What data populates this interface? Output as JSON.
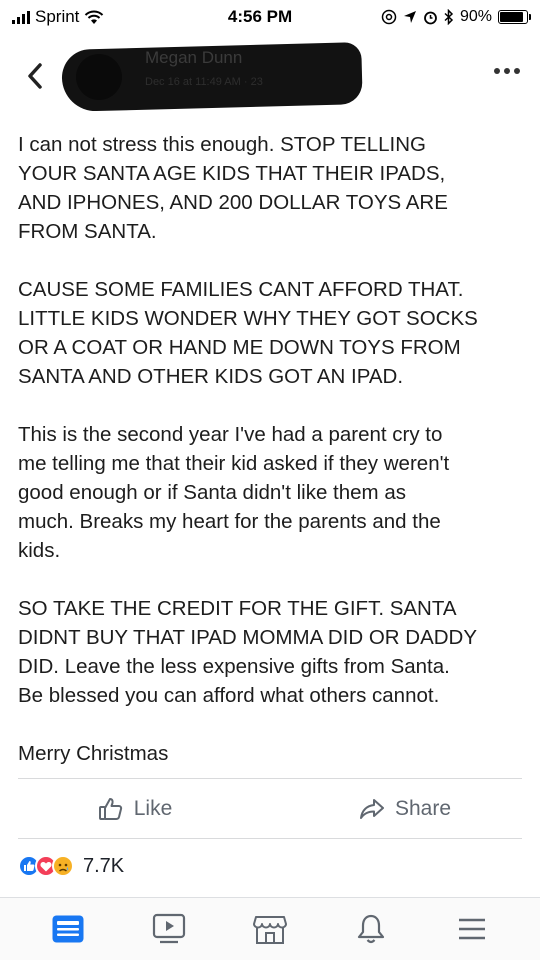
{
  "status_bar": {
    "carrier": "Sprint",
    "time": "4:56 PM",
    "battery_percent": "90%",
    "battery_level": 0.9,
    "icons": [
      "signal-icon",
      "wifi-icon",
      "at-icon",
      "location-icon",
      "alarm-icon",
      "bluetooth-icon",
      "battery-icon"
    ]
  },
  "header": {
    "author_name": "Megan Dunn",
    "meta": "Dec 16 at 11:49 AM · 23",
    "icons": [
      "back-chevron-icon",
      "more-options-icon"
    ]
  },
  "post": {
    "paragraphs": [
      "I can not stress this enough. STOP TELLING\nYOUR SANTA AGE KIDS THAT THEIR IPADS,\nAND IPHONES, AND 200 DOLLAR TOYS ARE\nFROM SANTA.",
      "CAUSE SOME FAMILIES CANT AFFORD THAT.\nLITTLE KIDS WONDER WHY THEY GOT SOCKS\nOR A COAT OR HAND ME DOWN TOYS FROM\nSANTA AND OTHER KIDS GOT AN IPAD.",
      "This is the second year I've had a parent cry to\nme telling me that their kid asked if they weren't\ngood enough or if Santa didn't like them as\nmuch.  Breaks my heart for the parents and the\nkids.",
      "SO TAKE THE CREDIT FOR THE GIFT. SANTA\nDIDNT BUY THAT IPAD MOMMA DID OR DADDY\nDID. Leave the less expensive gifts from Santa.\nBe blessed you can afford what others cannot.",
      "Merry Christmas"
    ]
  },
  "actions": {
    "like_label": "Like",
    "share_label": "Share"
  },
  "reactions": {
    "count": "7.7K",
    "types": [
      "like-reaction-icon",
      "love-reaction-icon",
      "sad-reaction-icon"
    ]
  },
  "bottom_nav": {
    "items": [
      "news-feed-icon",
      "watch-icon",
      "marketplace-icon",
      "notifications-icon",
      "menu-icon"
    ],
    "active": "news-feed-icon"
  },
  "colors": {
    "facebook_blue": "#1877f2",
    "icon_gray": "#606770",
    "text": "#1d1d1d"
  }
}
